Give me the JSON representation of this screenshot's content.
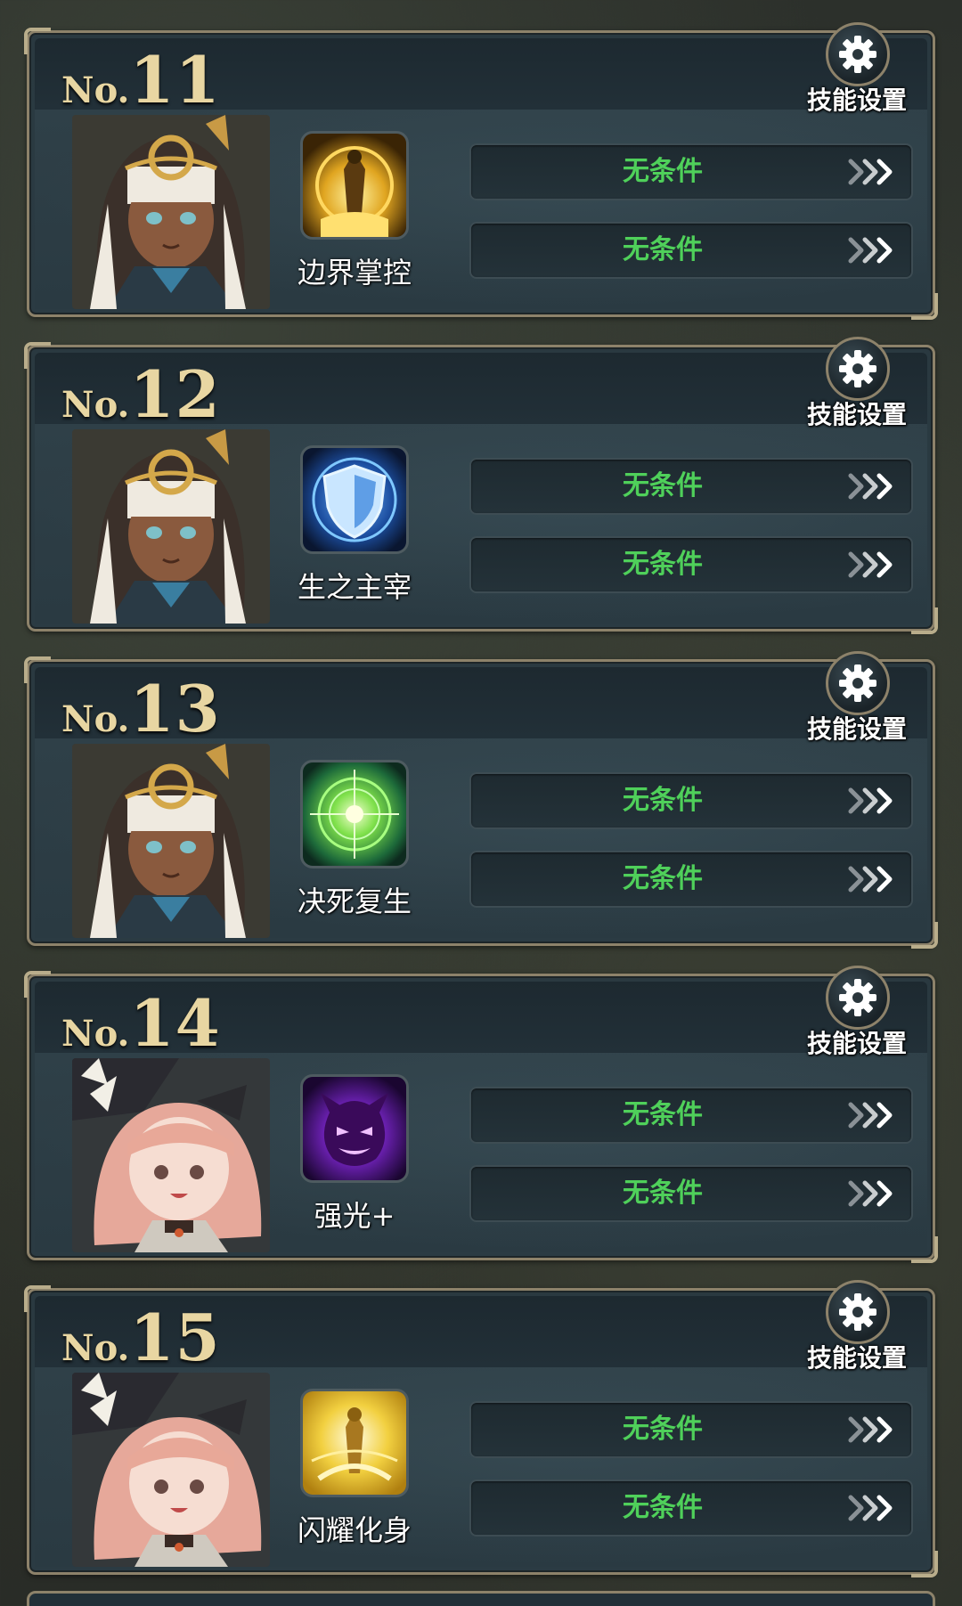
{
  "settings_label": "技能设置",
  "number_prefix": "No.",
  "cards": [
    {
      "number": "11",
      "skill": "边界掌控",
      "skill_icon": "golden-warrior-icon",
      "portrait": "dark-haired-priestess",
      "conditions": [
        "无条件",
        "无条件"
      ]
    },
    {
      "number": "12",
      "skill": "生之主宰",
      "skill_icon": "blue-shield-icon",
      "portrait": "dark-haired-priestess",
      "conditions": [
        "无条件",
        "无条件"
      ]
    },
    {
      "number": "13",
      "skill": "决死复生",
      "skill_icon": "green-orb-icon",
      "portrait": "dark-haired-priestess",
      "conditions": [
        "无条件",
        "无条件"
      ]
    },
    {
      "number": "14",
      "skill": "强光+",
      "skill_icon": "purple-demon-icon",
      "portrait": "pink-haired-witch",
      "conditions": [
        "无条件",
        "无条件"
      ]
    },
    {
      "number": "15",
      "skill": "闪耀化身",
      "skill_icon": "golden-radiance-icon",
      "portrait": "pink-haired-witch",
      "conditions": [
        "无条件",
        "无条件"
      ]
    }
  ],
  "colors": {
    "condition_text": "#4fd05a",
    "frame_gold": "#8d826a",
    "number_gold": "#e8d6a2"
  }
}
